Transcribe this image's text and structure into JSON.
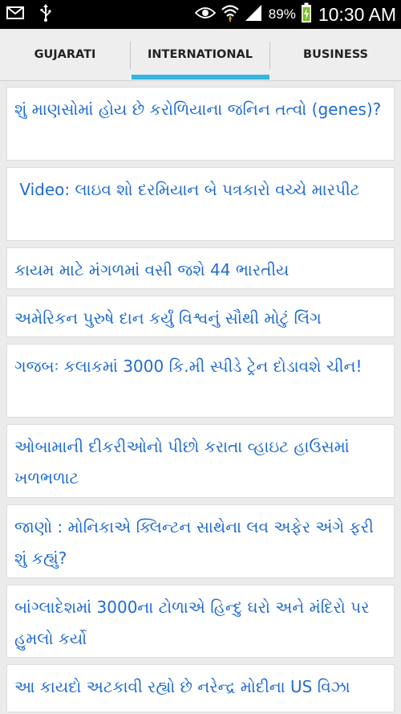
{
  "status_bar": {
    "battery_percent": "89%",
    "time": "10:30 AM",
    "icons": [
      "mail-icon",
      "usb-icon",
      "eye-icon",
      "wifi-icon",
      "signal-icon",
      "battery-charging-icon"
    ]
  },
  "tabs": [
    {
      "label": "GUJARATI",
      "selected": false
    },
    {
      "label": "INTERNATIONAL",
      "selected": true
    },
    {
      "label": "BUSINESS",
      "selected": false
    }
  ],
  "colors": {
    "accent": "#33b5e5",
    "headline": "#1f6bd4",
    "background": "#ebebeb"
  },
  "articles": [
    {
      "title": "શું માણસોમાં હોય છે કરોળિયાના જનિન તત્વો (genes)?"
    },
    {
      "title": " Video: લાઇવ શો દરમિયાન બે પત્રકારો વચ્ચે મારપીટ"
    },
    {
      "title": "કાયમ માટે મંગળમાં વસી જશે 44 ભારતીય"
    },
    {
      "title": "અમેરિકન પુરુષે દાન કર્યું વિશ્વનું સૌથી મોટું લિંગ"
    },
    {
      "title": "ગજબઃ કલાકમાં 3000 કિ.મી સ્પીડે ટ્રેન દોડાવશે ચીન!"
    },
    {
      "title": "ઓબામાની દીકરીઓનો પીછો કરાતા વ્હાઇટ હાઉસમાં ખળભળાટ"
    },
    {
      "title": "જાણો : મોનિકાએ ક્લિન્ટન સાથેના લવ અફેર અંગે ફરી શું કહ્યું?"
    },
    {
      "title": "બાંગ્લાદેશમાં 3000ના ટોળાએ હિન્દુ ઘરો અને મંદિરો પર હુમલો કર્યો"
    },
    {
      "title": "આ કાયદો અટકાવી રહ્યો છે નરેન્દ્ર મોદીના US વિઝા"
    }
  ]
}
